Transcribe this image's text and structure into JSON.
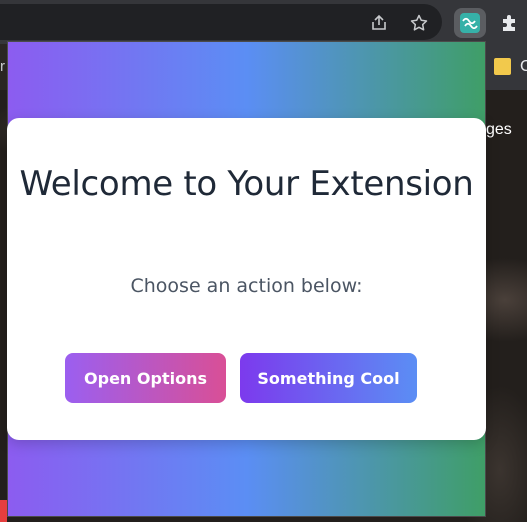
{
  "toolbar": {
    "icons": [
      "share-icon",
      "star-icon",
      "extension-logo-icon",
      "puzzle-icon"
    ]
  },
  "bookmarks": {
    "partial_label": "C"
  },
  "background_page": {
    "partial_text": "ges",
    "left_partial": "r"
  },
  "popup": {
    "title": "Welcome to Your Extension",
    "subtitle": "Choose an action below:",
    "buttons": {
      "open_options": "Open Options",
      "something_cool": "Something Cool"
    },
    "colors": {
      "gradient_start": "#8c5cf0",
      "gradient_mid": "#5b8ef4",
      "gradient_end": "#3f9e67",
      "title_color": "#1f2937"
    }
  }
}
